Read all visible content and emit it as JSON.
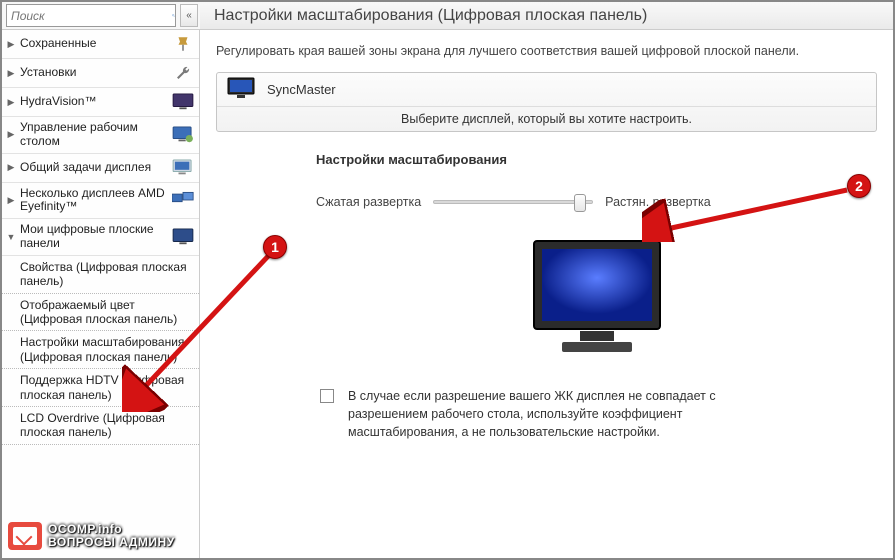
{
  "search": {
    "placeholder": "Поиск"
  },
  "header": {
    "title": "Настройки масштабирования (Цифровая плоская панель)"
  },
  "sidebar": {
    "items": [
      {
        "label": "Сохраненные"
      },
      {
        "label": "Установки"
      },
      {
        "label": "HydraVision™"
      },
      {
        "label": "Управление рабочим столом"
      },
      {
        "label": "Общий задачи дисплея"
      },
      {
        "label": "Несколько дисплеев AMD Eyefinity™"
      },
      {
        "label": "Мои цифровые плоские панели"
      }
    ],
    "sub": [
      {
        "label": "Свойства (Цифровая плоская панель)"
      },
      {
        "label": "Отображаемый цвет (Цифровая плоская панель)"
      },
      {
        "label": "Настройки масштабирования (Цифровая плоская панель)"
      },
      {
        "label": "Поддержка HDTV (Цифровая плоская панель)"
      },
      {
        "label": "LCD Overdrive (Цифровая плоская панель)"
      }
    ]
  },
  "main": {
    "description": "Регулировать края вашей зоны экрана для лучшего соответствия вашей цифровой плоской панели.",
    "display_name": "SyncMaster",
    "display_hint": "Выберите дисплей, который вы хотите настроить.",
    "panel_title": "Настройки масштабирования",
    "slider_left": "Сжатая развертка",
    "slider_right": "Растян. развертка",
    "note": "В случае если разрешение вашего ЖК дисплея не совпадает с разрешением рабочего стола, используйте коэффициент масштабирования, а не пользовательские настройки."
  },
  "annotations": {
    "badge1": "1",
    "badge2": "2"
  },
  "watermark": {
    "line1": "OCOMP.info",
    "line2": "ВОПРОСЫ АДМИНУ"
  }
}
